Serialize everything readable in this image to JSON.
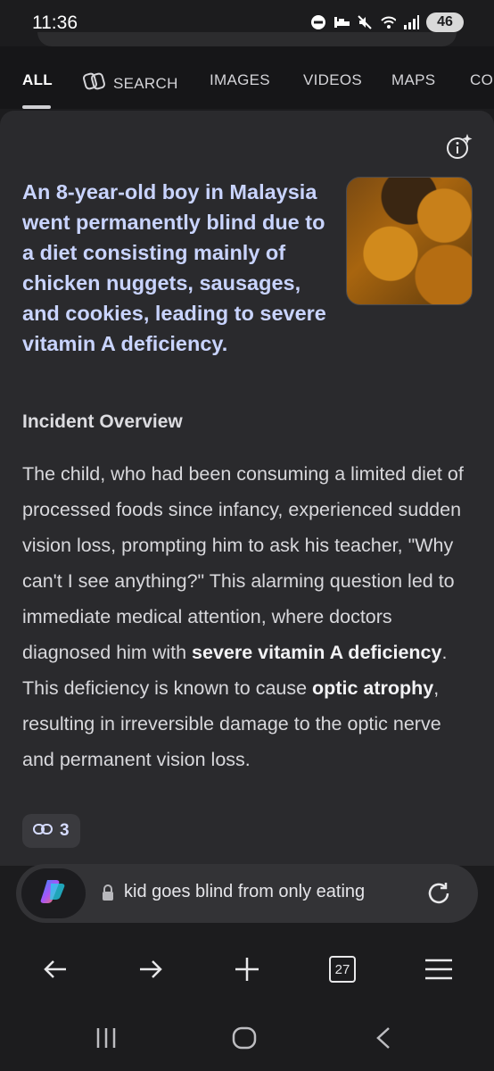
{
  "status": {
    "time": "11:36",
    "battery": "46",
    "icons": [
      "do-not-disturb-icon",
      "sleep-icon",
      "mute-icon",
      "wifi-icon",
      "signal-icon"
    ]
  },
  "tabs": [
    {
      "label": "ALL",
      "active": true
    },
    {
      "label": "SEARCH",
      "icon": "copilot-search-icon"
    },
    {
      "label": "IMAGES"
    },
    {
      "label": "VIDEOS"
    },
    {
      "label": "MAPS"
    },
    {
      "label": "CO"
    }
  ],
  "answer": {
    "headline": "An 8-year-old boy in Malaysia went permanently blind due to a diet consisting mainly of chicken nuggets, sausages, and cookies, leading to severe vitamin A deficiency.",
    "section_title": "Incident Overview",
    "paragraph": [
      {
        "text": "The child, who had been consuming a limited diet of processed foods since infancy, experienced sudden vision loss, prompting him to ask his teacher, \"Why can't I see anything?\" This alarming question led to immediate medical attention, where doctors diagnosed him with "
      },
      {
        "text": "severe vitamin A deficiency",
        "bold": true
      },
      {
        "text": ". This deficiency is known to cause "
      },
      {
        "text": "optic atrophy",
        "bold": true
      },
      {
        "text": ", resulting in irreversible damage to the optic nerve and permanent vision loss."
      }
    ],
    "citation_count": "3"
  },
  "address_bar": {
    "query": "kid goes blind from only eating"
  },
  "nav": {
    "tab_count": "27"
  },
  "colors": {
    "headline": "#c9d4ff",
    "card": "#2a2a2d",
    "background": "#1c1c1e"
  }
}
